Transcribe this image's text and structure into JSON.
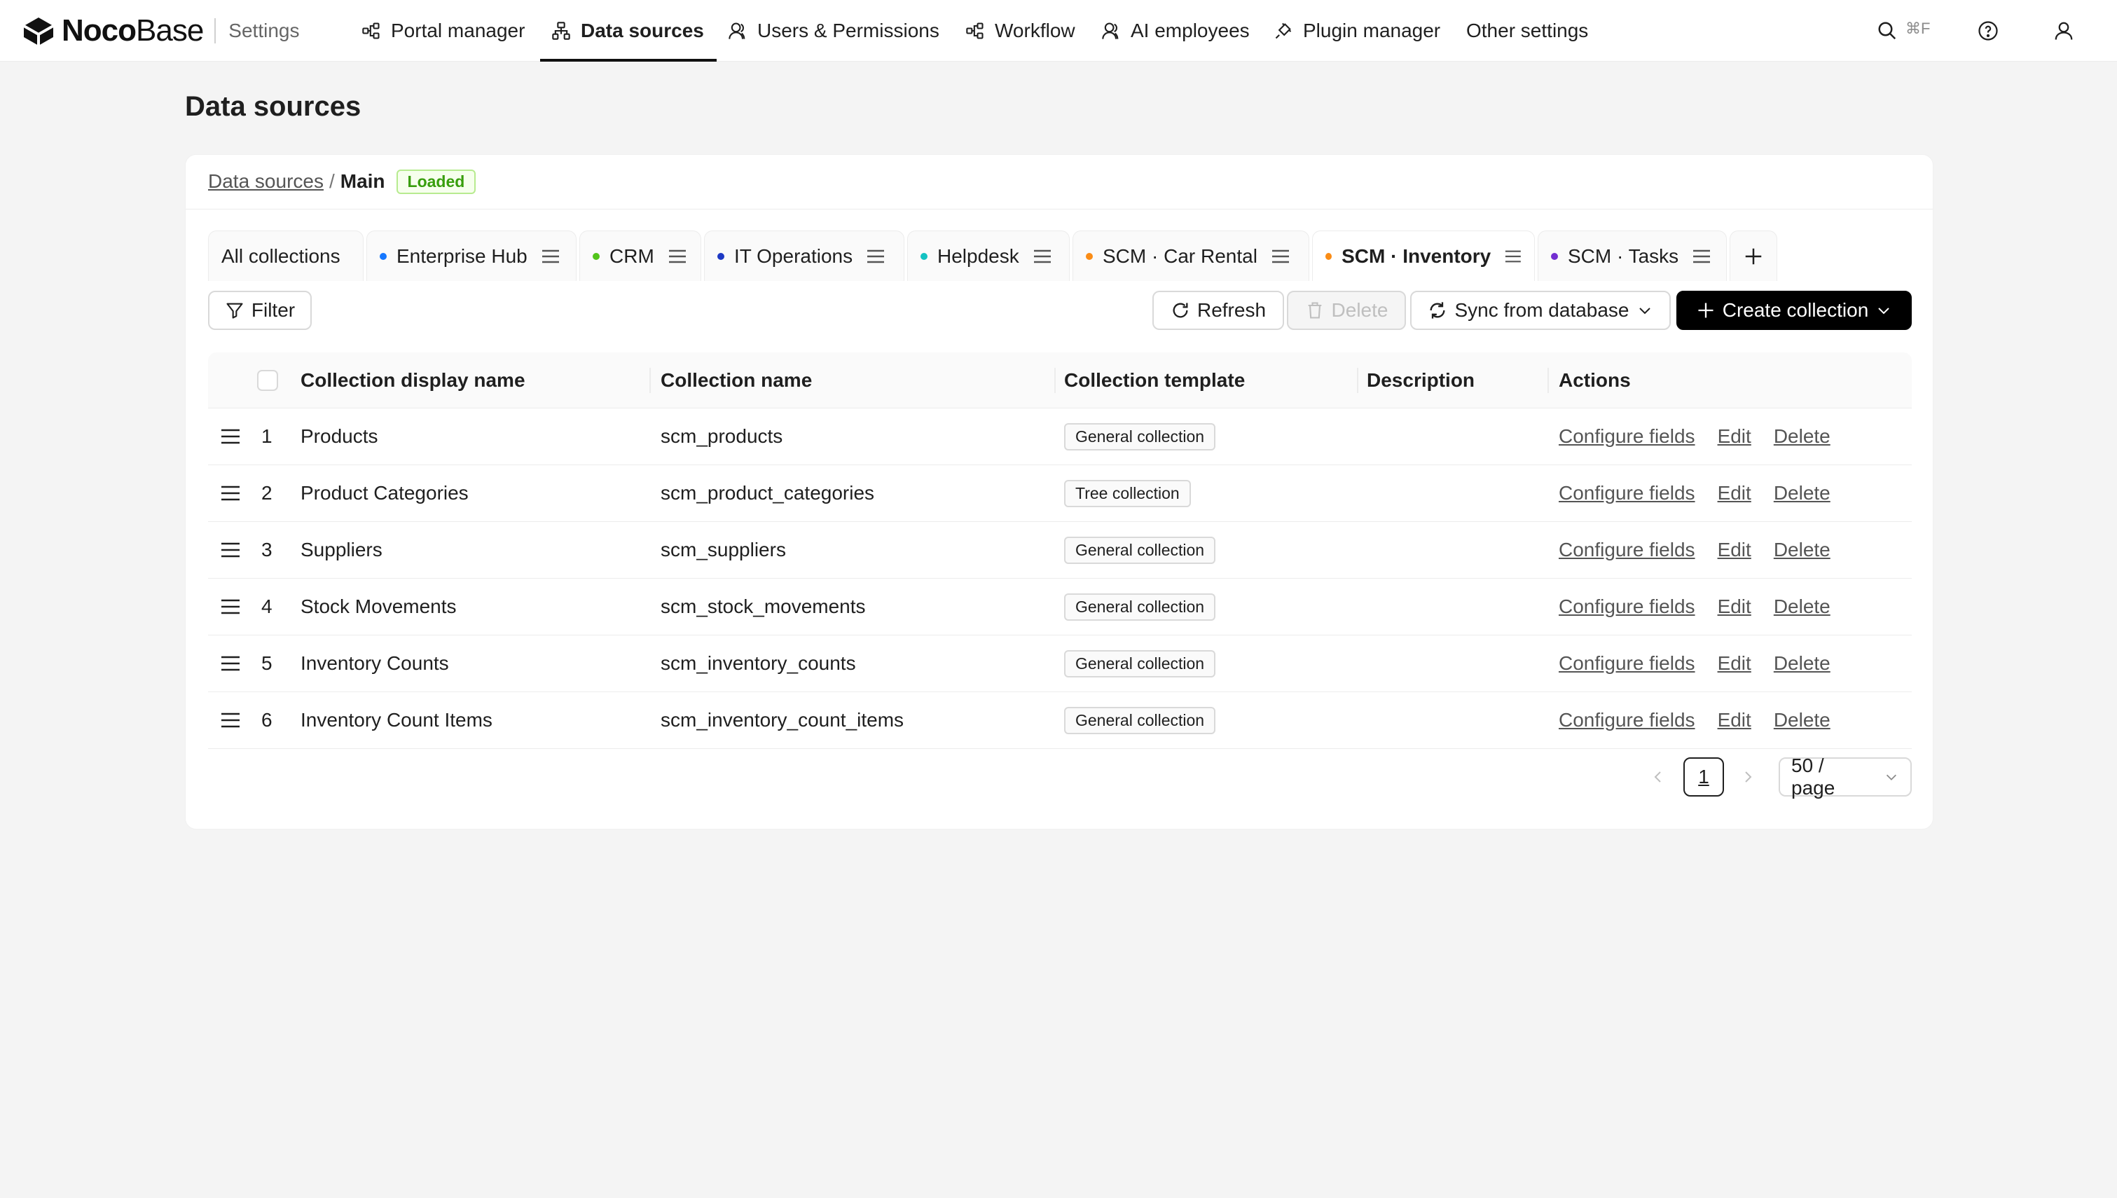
{
  "header": {
    "brand_bold": "Noco",
    "brand_regular": "Base",
    "section": "Settings",
    "nav": [
      {
        "label": "Portal manager",
        "icon": "portal-icon"
      },
      {
        "label": "Data sources",
        "icon": "data-sources-icon",
        "active": true
      },
      {
        "label": "Users & Permissions",
        "icon": "users-icon"
      },
      {
        "label": "Workflow",
        "icon": "workflow-icon"
      },
      {
        "label": "AI employees",
        "icon": "ai-employee-icon"
      },
      {
        "label": "Plugin manager",
        "icon": "plugin-icon"
      },
      {
        "label": "Other settings",
        "icon": ""
      }
    ],
    "search_shortcut": "⌘F"
  },
  "page": {
    "title": "Data sources",
    "breadcrumb": {
      "link": "Data sources",
      "separator": "/",
      "current": "Main"
    },
    "status_badge": "Loaded"
  },
  "tabs": [
    {
      "label": "All collections",
      "dot": null
    },
    {
      "label": "Enterprise Hub",
      "dot": "#1677ff"
    },
    {
      "label": "CRM",
      "dot": "#52c41a"
    },
    {
      "label": "IT Operations",
      "dot": "#1d39c4"
    },
    {
      "label": "Helpdesk",
      "dot": "#13c2c2"
    },
    {
      "label": "SCM · Car Rental",
      "dot": "#fa8c16"
    },
    {
      "label": "SCM · Inventory",
      "dot": "#fa8c16",
      "active": true
    },
    {
      "label": "SCM · Tasks",
      "dot": "#722ed1"
    }
  ],
  "toolbar": {
    "filter": "Filter",
    "refresh": "Refresh",
    "delete": "Delete",
    "sync": "Sync from database",
    "create": "Create collection"
  },
  "table": {
    "columns": [
      "Collection display name",
      "Collection name",
      "Collection template",
      "Description",
      "Actions"
    ],
    "rows": [
      {
        "num": "1",
        "display": "Products",
        "name": "scm_products",
        "template": "General collection",
        "description": ""
      },
      {
        "num": "2",
        "display": "Product Categories",
        "name": "scm_product_categories",
        "template": "Tree collection",
        "description": ""
      },
      {
        "num": "3",
        "display": "Suppliers",
        "name": "scm_suppliers",
        "template": "General collection",
        "description": ""
      },
      {
        "num": "4",
        "display": "Stock Movements",
        "name": "scm_stock_movements",
        "template": "General collection",
        "description": ""
      },
      {
        "num": "5",
        "display": "Inventory Counts",
        "name": "scm_inventory_counts",
        "template": "General collection",
        "description": ""
      },
      {
        "num": "6",
        "display": "Inventory Count Items",
        "name": "scm_inventory_count_items",
        "template": "General collection",
        "description": ""
      }
    ],
    "actions": {
      "configure": "Configure fields",
      "edit": "Edit",
      "delete": "Delete"
    }
  },
  "pagination": {
    "current_page": "1",
    "page_size": "50 / page"
  },
  "colors": {
    "primary": "#000000",
    "link": "#555555",
    "success": "#389e0d",
    "background": "#f4f4f4"
  }
}
